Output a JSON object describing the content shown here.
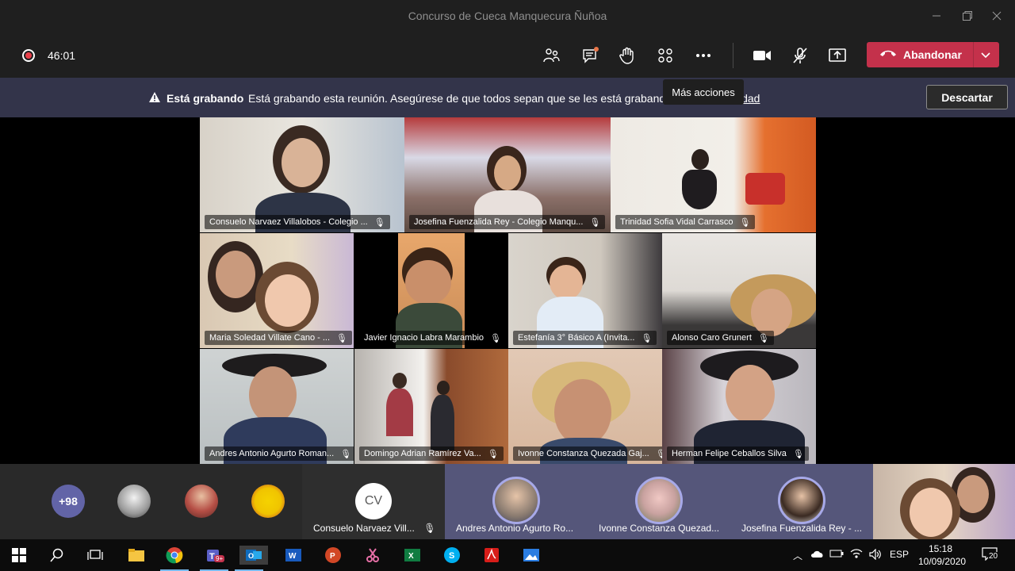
{
  "window": {
    "title": "Concurso de Cueca Manquecura Ñuñoa"
  },
  "toolbar": {
    "timer": "46:01",
    "leave_label": "Abandonar",
    "tooltip": "Más acciones",
    "icons": [
      "people-icon",
      "chat-icon",
      "raise-hand-icon",
      "breakout-icon",
      "more-actions-icon",
      "camera-icon",
      "mic-off-icon",
      "share-icon"
    ]
  },
  "banner": {
    "bold": "Está grabando",
    "message": "Está grabando esta reunión. Asegúrese de que todos sepan que se les está grabando",
    "link": "cidad",
    "dismiss": "Descartar"
  },
  "tiles": [
    {
      "name": "Consuelo Narvaez Villalobos - Colegio ..."
    },
    {
      "name": "Josefina Fuenzalida Rey - Colegio Manqu..."
    },
    {
      "name": "Trinidad Sofia Vidal Carrasco"
    },
    {
      "name": "Maria Soledad Villate Cano - ..."
    },
    {
      "name": "Javier Ignacio Labra Marambio"
    },
    {
      "name": "Estefanía 3° Básico A (Invita..."
    },
    {
      "name": "Alonso Caro Grunert"
    },
    {
      "name": "Andres Antonio Agurto Roman..."
    },
    {
      "name": "Domingo Adrian Ramírez Va..."
    },
    {
      "name": "Ivonne Constanza Quezada Gaj..."
    },
    {
      "name": "Herman Felipe Ceballos Silva"
    }
  ],
  "strip": {
    "more_count": "+98",
    "cv_initials": "CV",
    "participants": [
      {
        "name": "Consuelo Narvaez Vill..."
      },
      {
        "name": "Andres Antonio Agurto Ro..."
      },
      {
        "name": "Ivonne Constanza Quezad..."
      },
      {
        "name": "Josefina Fuenzalida Rey - ..."
      }
    ]
  },
  "taskbar": {
    "language": "ESP",
    "time": "15:18",
    "date": "10/09/2020",
    "notifications": "20",
    "teams_badge": "9+"
  },
  "colors": {
    "accent": "#6264a7",
    "leave": "#c4314b",
    "banner": "#33344a"
  }
}
